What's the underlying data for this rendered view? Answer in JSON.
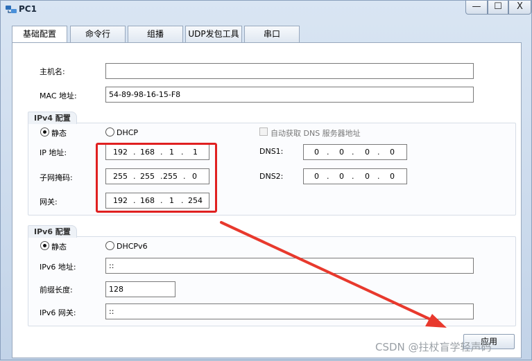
{
  "window": {
    "title": "PC1",
    "minimize_glyph": "—",
    "maximize_glyph": "☐",
    "close_glyph": "X",
    "icon": "pc-network-icon"
  },
  "tabs": [
    {
      "label": "基础配置",
      "active": true
    },
    {
      "label": "命令行",
      "active": false
    },
    {
      "label": "组播",
      "active": false
    },
    {
      "label": "UDP发包工具",
      "active": false
    },
    {
      "label": "串口",
      "active": false
    }
  ],
  "basic": {
    "hostname_label": "主机名:",
    "hostname_value": "",
    "mac_label": "MAC 地址:",
    "mac_value": "54-89-98-16-15-F8"
  },
  "ipv4": {
    "group_title": "IPv4 配置",
    "static_label": "静态",
    "dhcp_label": "DHCP",
    "auto_dns_label": "自动获取 DNS 服务器地址",
    "ip_label": "IP 地址:",
    "ip": [
      "192",
      "168",
      "1",
      "1"
    ],
    "mask_label": "子网掩码:",
    "mask": [
      "255",
      "255",
      "255",
      "0"
    ],
    "gateway_label": "网关:",
    "gateway": [
      "192",
      "168",
      "1",
      "254"
    ],
    "dns1_label": "DNS1:",
    "dns1": [
      "0",
      "0",
      "0",
      "0"
    ],
    "dns2_label": "DNS2:",
    "dns2": [
      "0",
      "0",
      "0",
      "0"
    ]
  },
  "ipv6": {
    "group_title": "IPv6 配置",
    "static_label": "静态",
    "dhcp_label": "DHCPv6",
    "addr_label": "IPv6 地址:",
    "addr_value": "::",
    "prefix_label": "前缀长度:",
    "prefix_value": "128",
    "gateway_label": "IPv6 网关:",
    "gateway_value": "::"
  },
  "apply_label": "应用",
  "watermark": "CSDN @拄杖盲学轻声码",
  "colors": {
    "highlight": "#e02020",
    "arrow": "#e8392d"
  }
}
